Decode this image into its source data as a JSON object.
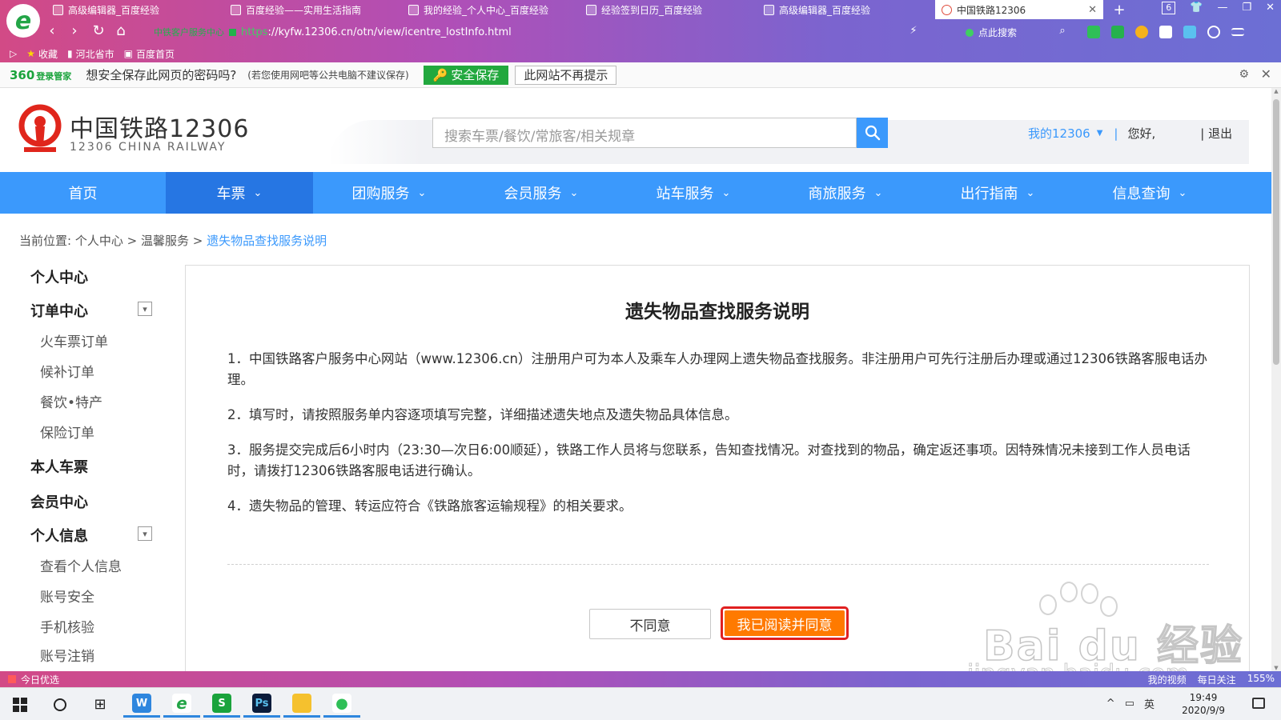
{
  "browser": {
    "tabs": [
      {
        "title": "高级编辑器_百度经验",
        "active": false
      },
      {
        "title": "百度经验——实用生活指南",
        "active": false
      },
      {
        "title": "我的经验_个人中心_百度经验",
        "active": false
      },
      {
        "title": "经验签到日历_百度经验",
        "active": false
      },
      {
        "title": "高级编辑器_百度经验",
        "active": false
      },
      {
        "title": "中国铁路12306",
        "active": true
      }
    ],
    "tab_count": "6",
    "address": {
      "site_label": "中铁客户服务中心",
      "protocol": "https",
      "url": "://kyfw.12306.cn/otn/view/icentre_lostInfo.html"
    },
    "search_label": "点此搜索",
    "bookmarks": [
      {
        "label": "收藏"
      },
      {
        "label": "河北省市"
      },
      {
        "label": "百度首页"
      }
    ]
  },
  "password_bar": {
    "brand": "360",
    "brand_sub": "登录管家",
    "question": "想安全保存此网页的密码吗?",
    "note": "(若您使用网吧等公共电脑不建议保存)",
    "save_button": "安全保存",
    "never_button": "此网站不再提示"
  },
  "site": {
    "name_cn": "中国铁路12306",
    "name_en": "12306 CHINA RAILWAY",
    "search_placeholder": "搜索车票/餐饮/常旅客/相关规章",
    "my_12306": "我的12306",
    "greeting": "您好,",
    "logout": "| 退出"
  },
  "nav": [
    {
      "label": "首页",
      "has_menu": false,
      "active": false
    },
    {
      "label": "车票",
      "has_menu": true,
      "active": true
    },
    {
      "label": "团购服务",
      "has_menu": true,
      "active": false
    },
    {
      "label": "会员服务",
      "has_menu": true,
      "active": false
    },
    {
      "label": "站车服务",
      "has_menu": true,
      "active": false
    },
    {
      "label": "商旅服务",
      "has_menu": true,
      "active": false
    },
    {
      "label": "出行指南",
      "has_menu": true,
      "active": false
    },
    {
      "label": "信息查询",
      "has_menu": true,
      "active": false
    }
  ],
  "breadcrumb": {
    "prefix": "当前位置:",
    "path": [
      "个人中心",
      "温馨服务"
    ],
    "current": "遗失物品查找服务说明"
  },
  "sidebar": [
    {
      "label": "个人中心",
      "type": "head"
    },
    {
      "label": "订单中心",
      "type": "head",
      "collapsible": true
    },
    {
      "label": "火车票订单",
      "type": "sub"
    },
    {
      "label": "候补订单",
      "type": "sub"
    },
    {
      "label": "餐饮•特产",
      "type": "sub"
    },
    {
      "label": "保险订单",
      "type": "sub"
    },
    {
      "label": "本人车票",
      "type": "head"
    },
    {
      "label": "会员中心",
      "type": "head"
    },
    {
      "label": "个人信息",
      "type": "head",
      "collapsible": true
    },
    {
      "label": "查看个人信息",
      "type": "sub"
    },
    {
      "label": "账号安全",
      "type": "sub"
    },
    {
      "label": "手机核验",
      "type": "sub"
    },
    {
      "label": "账号注销",
      "type": "sub"
    }
  ],
  "content": {
    "title": "遗失物品查找服务说明",
    "paragraphs": [
      "1．中国铁路客户服务中心网站（www.12306.cn）注册用户可为本人及乘车人办理网上遗失物品查找服务。非注册用户可先行注册后办理或通过12306铁路客服电话办理。",
      "2．填写时，请按照服务单内容逐项填写完整，详细描述遗失地点及遗失物品具体信息。",
      "3．服务提交完成后6小时内（23:30—次日6:00顺延），铁路工作人员将与您联系，告知查找情况。对查找到的物品，确定返还事项。因特殊情况未接到工作人员电话时，请拨打12306铁路客服电话进行确认。",
      "4．遗失物品的管理、转运应符合《铁路旅客运输规程》的相关要求。"
    ],
    "disagree_button": "不同意",
    "agree_button": "我已阅读并同意"
  },
  "watermark": {
    "text": "Bai du 经验",
    "url": "jingyan.baidu.com"
  },
  "statusbar": {
    "left": "今日优选",
    "right": [
      "我的视频",
      "每日关注",
      "155%"
    ]
  },
  "taskbar": {
    "time": "19:49",
    "date": "2020/9/9",
    "ime": "英"
  },
  "colors": {
    "brand_blue": "#3b99fc",
    "nav_active": "#2676e3",
    "rail_red": "#e0261c",
    "agree_orange": "#ff7a00",
    "highlight_red": "#e02020",
    "save_green": "#22a83e"
  }
}
